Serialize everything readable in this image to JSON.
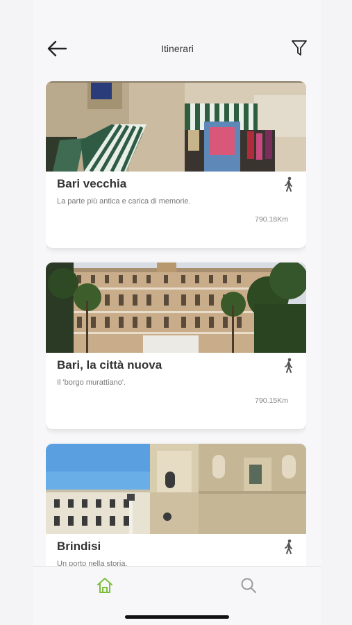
{
  "header": {
    "title": "Itinerari",
    "back_icon": "arrow-left-icon",
    "filter_icon": "filter-funnel-icon"
  },
  "itineraries": [
    {
      "name": "Bari vecchia",
      "description": "La parte più antica e carica di memorie.",
      "distance": "790.18Km",
      "mode_icon": "walking-person-icon"
    },
    {
      "name": "Bari, la città nuova",
      "description": "Il 'borgo murattiano'.",
      "distance": "790.15Km",
      "mode_icon": "walking-person-icon"
    },
    {
      "name": "Brindisi",
      "description": "Un porto nella storia.",
      "mode_icon": "walking-person-icon"
    }
  ],
  "tabbar": {
    "home_icon": "home-icon",
    "search_icon": "search-icon",
    "active_tab": "home",
    "active_color": "#7cbf3a",
    "inactive_color": "#9a9a9a"
  }
}
